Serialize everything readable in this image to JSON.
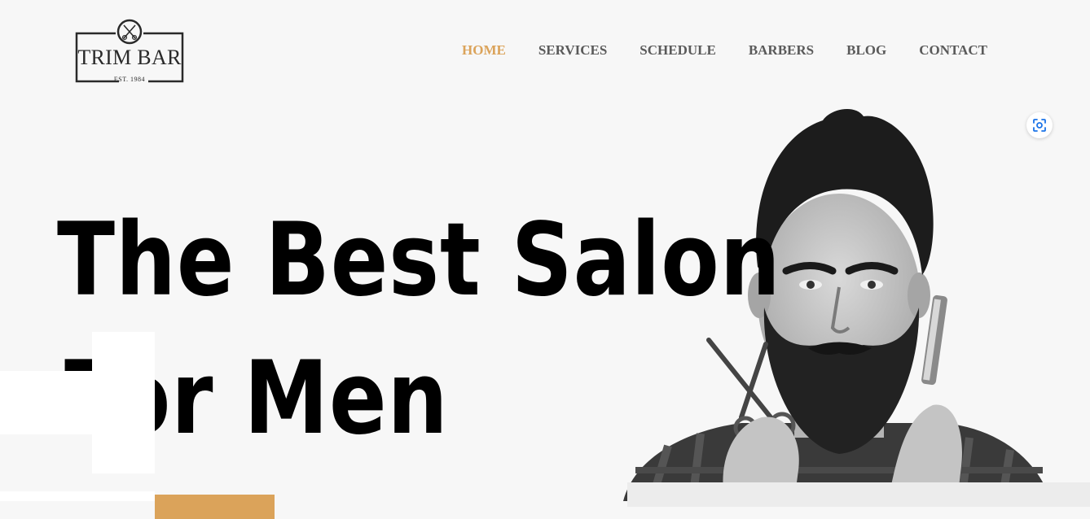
{
  "brand": {
    "name": "TRIM BAR",
    "established": "EST. 1984"
  },
  "nav": {
    "items": [
      {
        "label": "HOME",
        "active": true
      },
      {
        "label": "SERVICES",
        "active": false
      },
      {
        "label": "SCHEDULE",
        "active": false
      },
      {
        "label": "BARBERS",
        "active": false
      },
      {
        "label": "BLOG",
        "active": false
      },
      {
        "label": "CONTACT",
        "active": false
      }
    ]
  },
  "hero": {
    "title_line1": "The Best Salon",
    "title_line2": "For Men"
  },
  "colors": {
    "accent": "#dba35a",
    "nav_text": "#5a5a5a",
    "background": "#f7f7f7",
    "title": "#000000"
  },
  "icons": {
    "logo": "scissors-circle-icon",
    "lens": "scan-lens-icon"
  }
}
